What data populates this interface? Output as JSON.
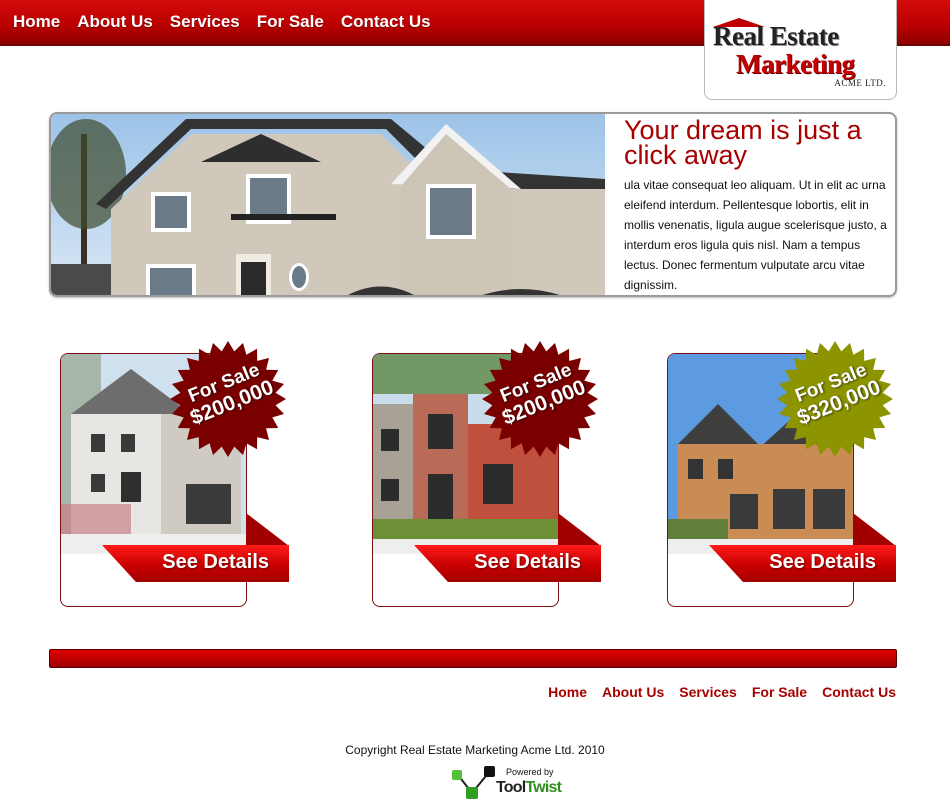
{
  "nav": {
    "items": [
      "Home",
      "About Us",
      "Services",
      "For Sale",
      "Contact Us"
    ]
  },
  "logo": {
    "line1": "Real Estate",
    "line2": "Marketing",
    "line3": "ACME LTD."
  },
  "hero": {
    "title": "Your dream is just a click away",
    "text": "ula vitae consequat leo aliquam. Ut in elit ac urna eleifend interdum. Pellentesque lobortis, elit in mollis venenatis, ligula augue scelerisque justo, a interdum eros ligula quis nisl. Nam a tempus lectus. Donec fermentum vulputate arcu vitae dignissim."
  },
  "listings": [
    {
      "badge_line1": "For Sale",
      "badge_line2": "$200,000",
      "badge_color": "#7a0000",
      "button": "See Details"
    },
    {
      "badge_line1": "For Sale",
      "badge_line2": "$200,000",
      "badge_color": "#7a0000",
      "button": "See Details"
    },
    {
      "badge_line1": "For Sale",
      "badge_line2": "$320,000",
      "badge_color": "#8c9400",
      "button": "See Details"
    }
  ],
  "footer": {
    "nav": [
      "Home",
      "About Us",
      "Services",
      "For Sale",
      "Contact Us"
    ],
    "copyright": "Copyright Real Estate Marketing Acme Ltd. 2010",
    "powered_by": "Powered by",
    "brand_part1": "Tool",
    "brand_part2": "Twist"
  },
  "colors": {
    "primary_red": "#c00000",
    "link_red": "#a80000",
    "badge_olive": "#8c9400"
  }
}
